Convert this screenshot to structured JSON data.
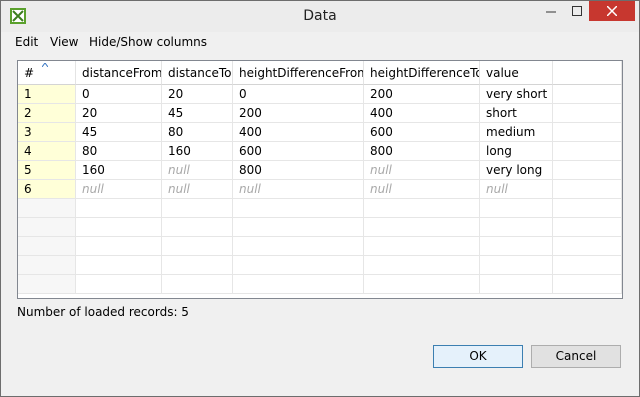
{
  "window": {
    "title": "Data"
  },
  "menu": [
    "Edit",
    "View",
    "Hide/Show columns"
  ],
  "table": {
    "headers": [
      "#",
      "distanceFrom",
      "distanceTo",
      "heightDifferenceFrom",
      "heightDifferenceTo",
      "value"
    ],
    "rows": [
      [
        "1",
        "0",
        "20",
        "0",
        "200",
        "very short"
      ],
      [
        "2",
        "20",
        "45",
        "200",
        "400",
        "short"
      ],
      [
        "3",
        "45",
        "80",
        "400",
        "600",
        "medium"
      ],
      [
        "4",
        "80",
        "160",
        "600",
        "800",
        "long"
      ],
      [
        "5",
        "160",
        "null",
        "800",
        "null",
        "very long"
      ],
      [
        "6",
        "null",
        "null",
        "null",
        "null",
        "null"
      ]
    ],
    "empty_rows": 5
  },
  "status": {
    "text": "Number of loaded records: 5"
  },
  "buttons": {
    "ok": "OK",
    "cancel": "Cancel"
  },
  "icons": {
    "app": "data-grid-app-icon",
    "sort": "sort-ascending-icon"
  },
  "colors": {
    "row_number_bg": "#ffffd8",
    "null_text": "#a9a9a9",
    "close_button": "#c7372f"
  }
}
